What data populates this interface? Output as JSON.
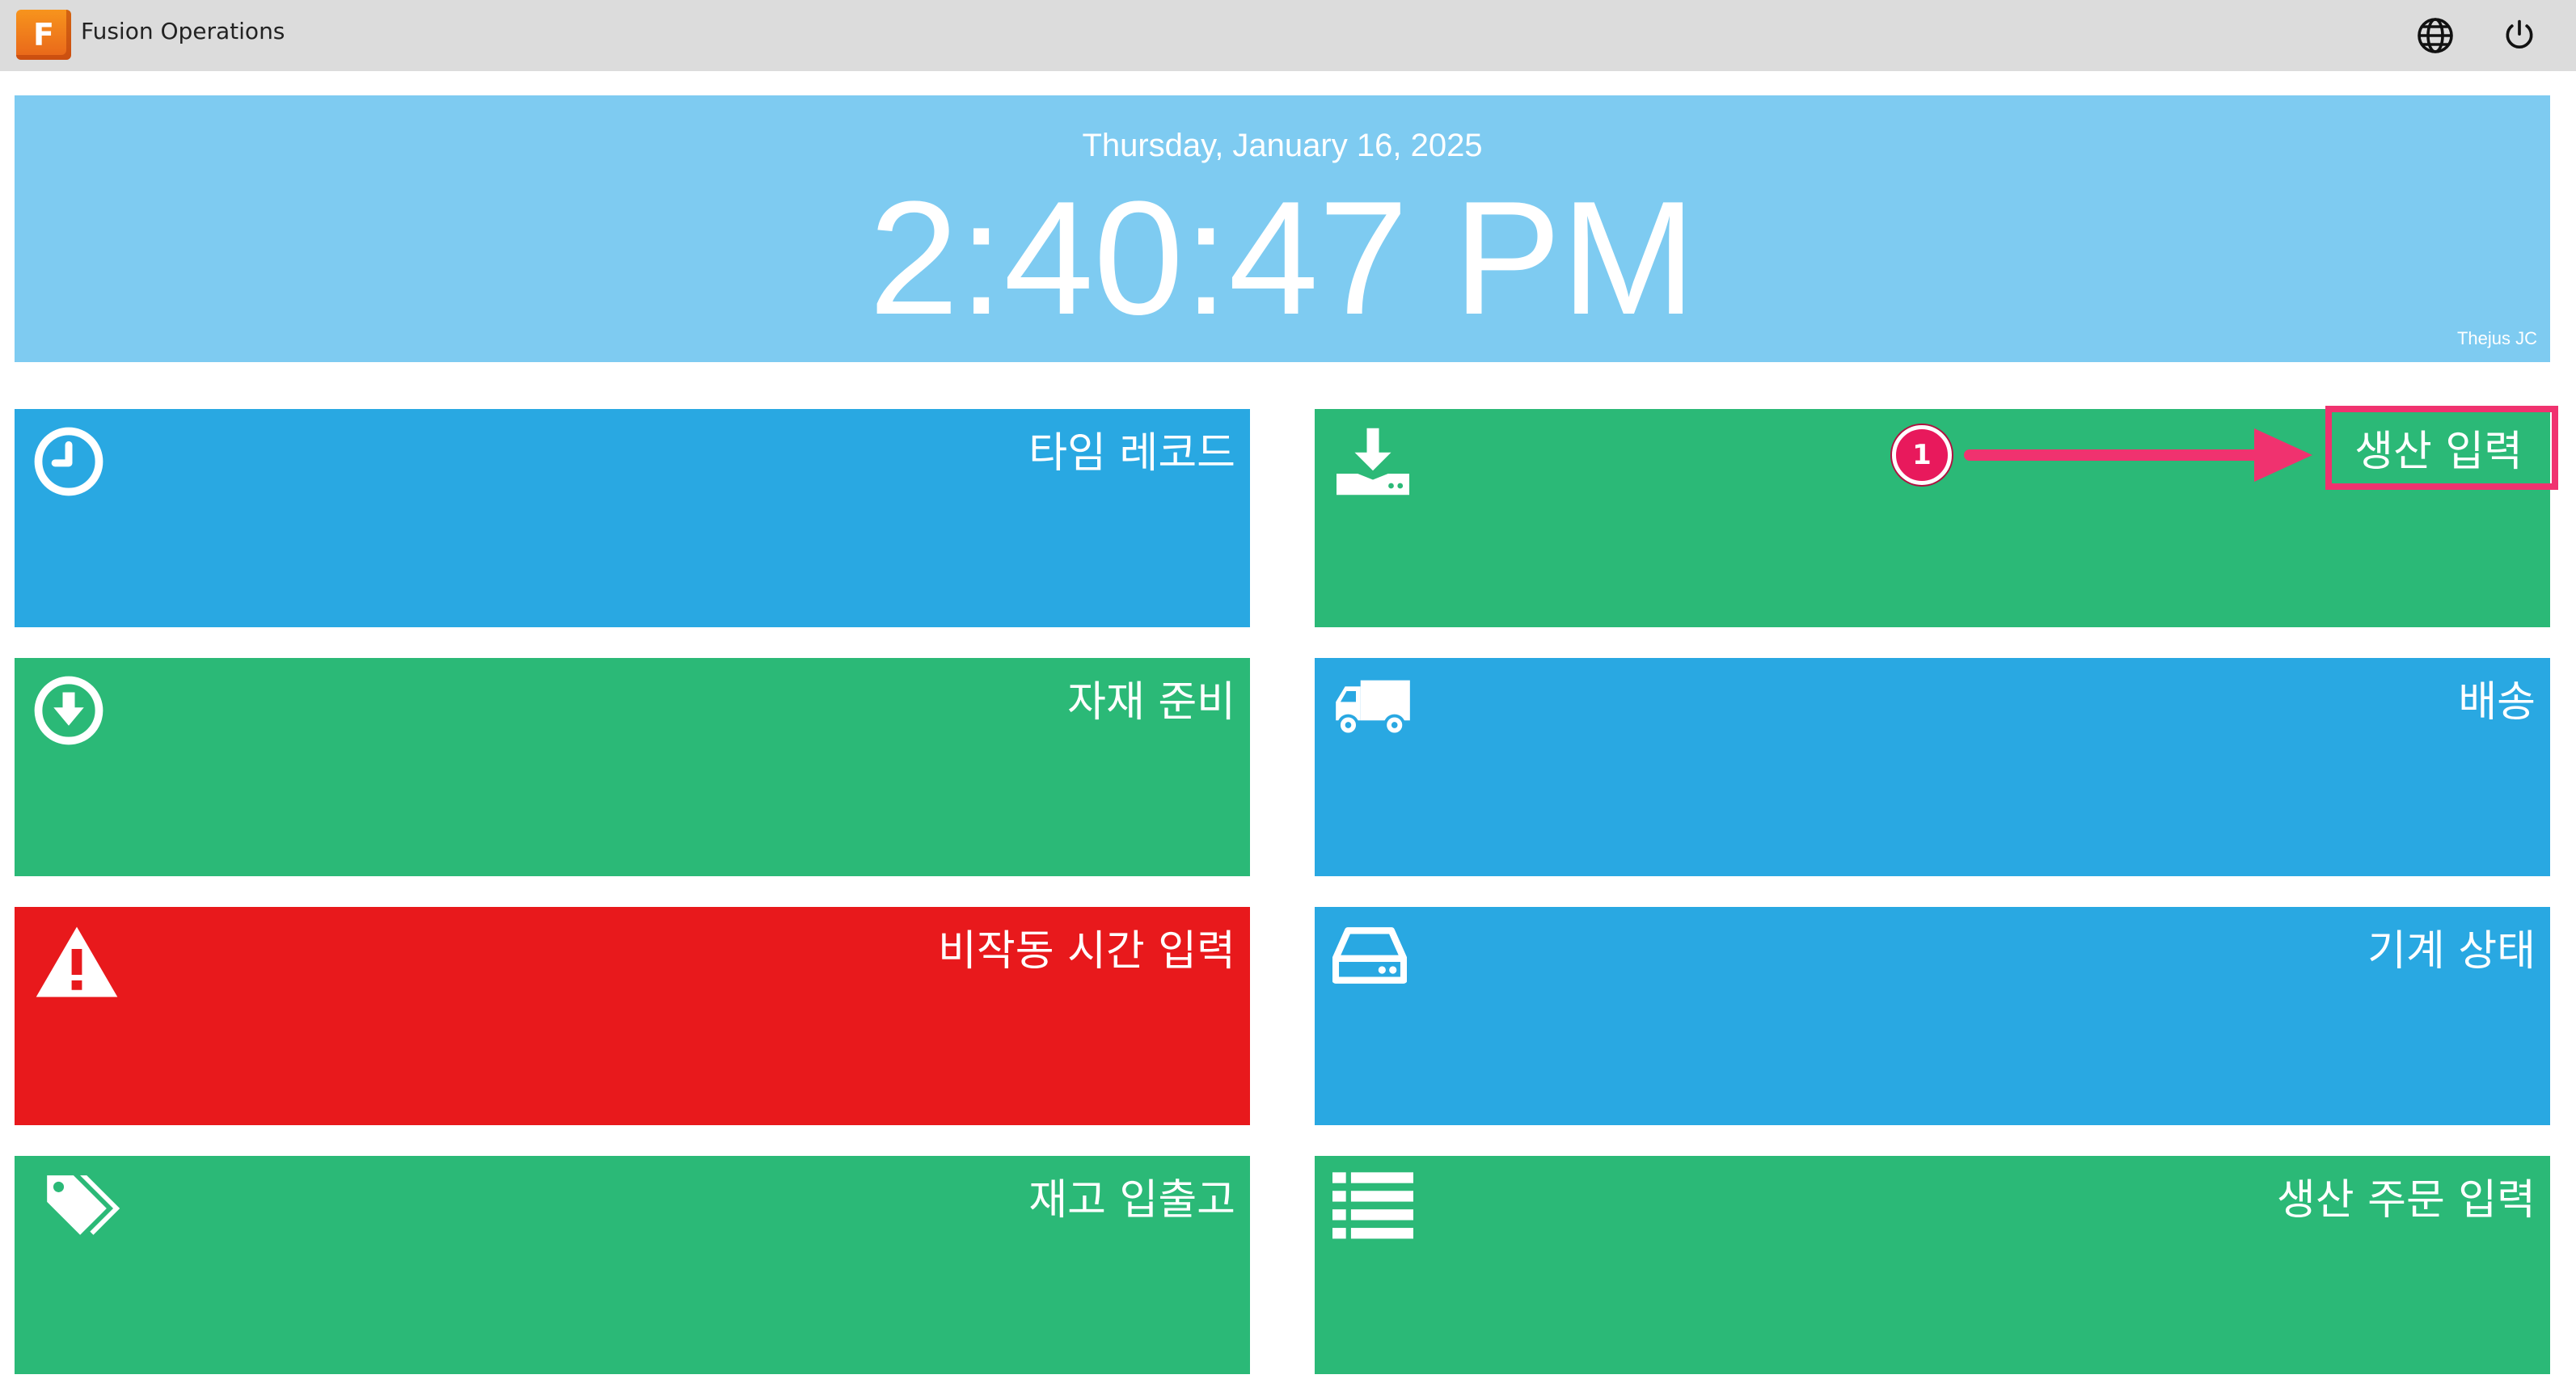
{
  "app": {
    "logo_letter": "F",
    "title": "Fusion Operations"
  },
  "header_icons": [
    "globe-icon",
    "power-icon"
  ],
  "clock": {
    "date": "Thursday, January 16, 2025",
    "time": "2:40:47 PM",
    "user": "Thejus JC"
  },
  "tiles": [
    {
      "label": "타임 레코드",
      "icon": "clock-icon",
      "color": "#29a8e2"
    },
    {
      "label": "생산 입력",
      "icon": "download-tray-icon",
      "color": "#2bb977"
    },
    {
      "label": "자재 준비",
      "icon": "circle-arrow-down-icon",
      "color": "#2bb977"
    },
    {
      "label": "배송",
      "icon": "truck-icon",
      "color": "#29a8e2"
    },
    {
      "label": "비작동 시간 입력",
      "icon": "warning-icon",
      "color": "#e8191c"
    },
    {
      "label": "기계 상태",
      "icon": "hard-drive-icon",
      "color": "#29a8e2"
    },
    {
      "label": "재고 입출고",
      "icon": "tags-icon",
      "color": "#2bb977"
    },
    {
      "label": "생산 주문 입력",
      "icon": "list-icon",
      "color": "#2bb977"
    }
  ],
  "annotation": {
    "step_number": "1",
    "color": "#f0326f"
  }
}
